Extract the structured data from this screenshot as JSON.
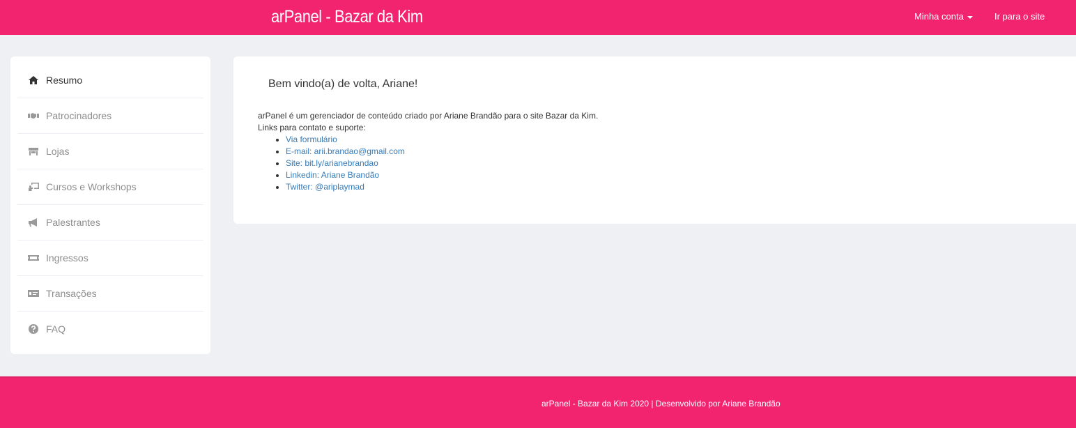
{
  "header": {
    "brand": "arPanel - Bazar da Kim",
    "account_label": "Minha conta",
    "site_label": "Ir para o site",
    "bg_color": "#f2246f"
  },
  "sidebar": {
    "items": [
      {
        "label": "Resumo",
        "icon": "home-icon",
        "active": true
      },
      {
        "label": "Patrocinadores",
        "icon": "handshake-icon"
      },
      {
        "label": "Lojas",
        "icon": "store-icon"
      },
      {
        "label": "Cursos e Workshops",
        "icon": "chalkboard-teacher-icon"
      },
      {
        "label": "Palestrantes",
        "icon": "megaphone-icon"
      },
      {
        "label": "Ingressos",
        "icon": "ticket-icon"
      },
      {
        "label": "Transações",
        "icon": "money-check-icon"
      },
      {
        "label": "FAQ",
        "icon": "question-circle-icon"
      }
    ]
  },
  "main": {
    "welcome": "Bem vindo(a) de volta, Ariane!",
    "description": "arPanel é um gerenciador de conteúdo criado por Ariane Brandão para o site Bazar da Kim.",
    "links_intro": "Links para contato e suporte:",
    "links": [
      "Via formulário",
      "E-mail: arii.brandao@gmail.com",
      "Site: bit.ly/arianebrandao",
      "Linkedin: Ariane Brandão",
      "Twitter: @ariplaymad"
    ],
    "link_color": "#337ab7"
  },
  "footer": {
    "text": "arPanel - Bazar da Kim 2020 | Desenvolvido por Ariane Brandão"
  }
}
